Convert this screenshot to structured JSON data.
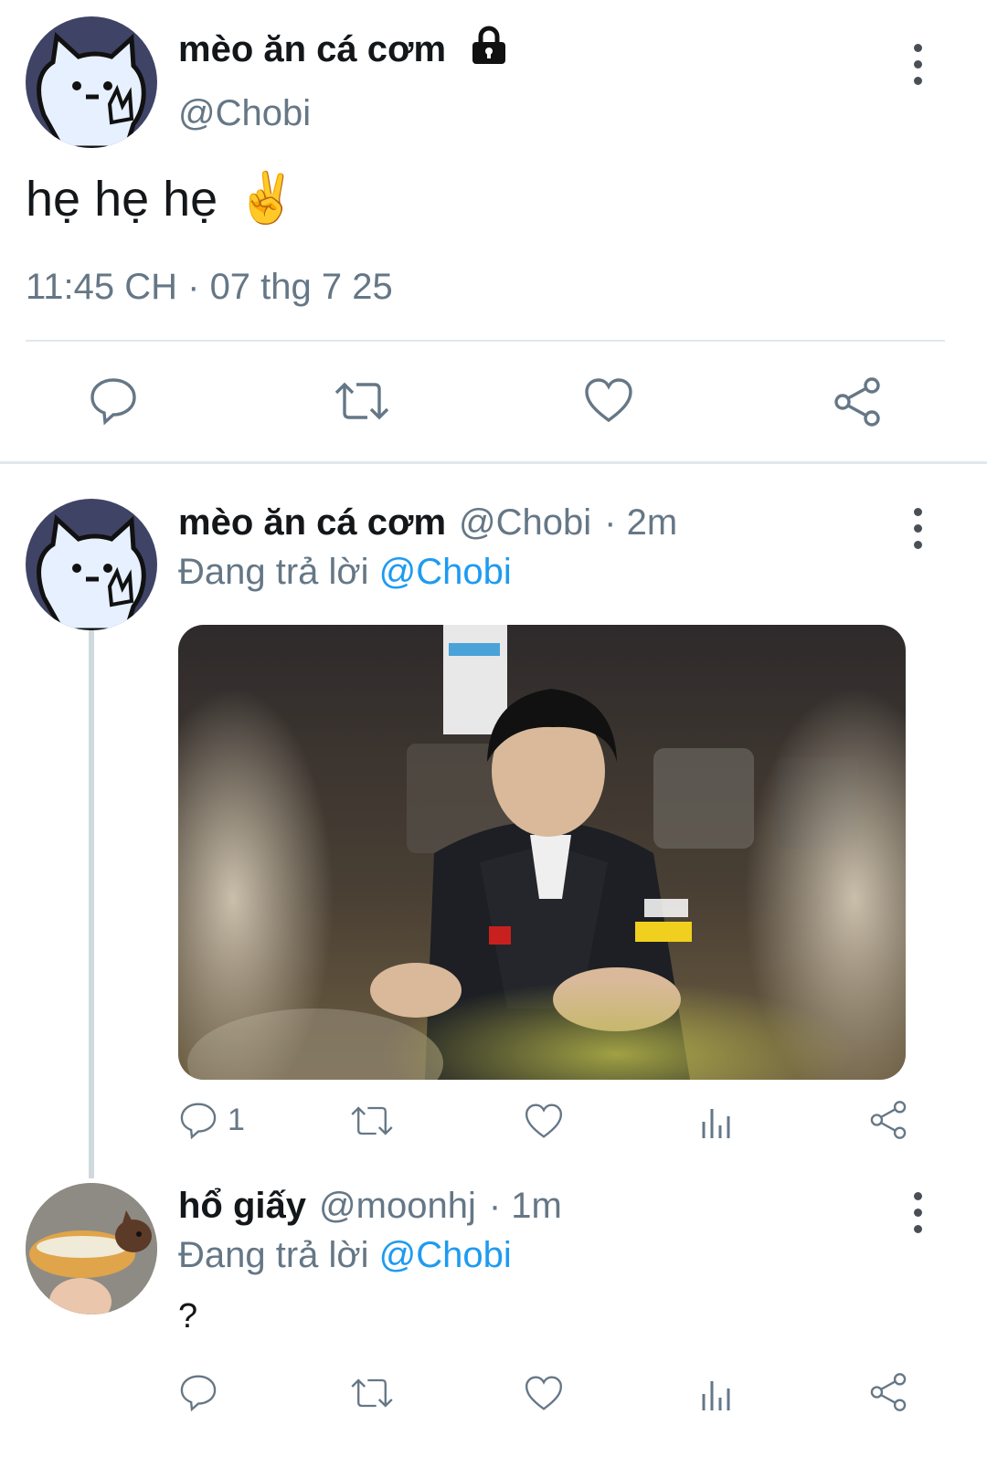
{
  "main_tweet": {
    "author_name": "mèo ăn cá cơm",
    "handle": "@Chobi",
    "locked": true,
    "text": "hẹ hẹ hẹ",
    "emoji": "✌️",
    "timestamp": "11:45 CH · 07 thg 7 25",
    "actions": [
      "reply-icon",
      "retweet-icon",
      "like-icon",
      "share-icon"
    ]
  },
  "replies": [
    {
      "author_name": "mèo ăn cá cơm",
      "handle": "@Chobi",
      "time": "· 2m",
      "replying_prefix": "Đang trả lời",
      "replying_to": "@Chobi",
      "reply_count": "1"
    },
    {
      "author_name": "hổ giấy",
      "handle": "@moonhj",
      "time": "· 1m",
      "replying_prefix": "Đang trả lời",
      "replying_to": "@Chobi",
      "text": "?"
    }
  ],
  "colors": {
    "link": "#1d9bf0",
    "muted": "#657786",
    "divider": "#e1e8ed",
    "avatar_bg": "#3f4466"
  }
}
